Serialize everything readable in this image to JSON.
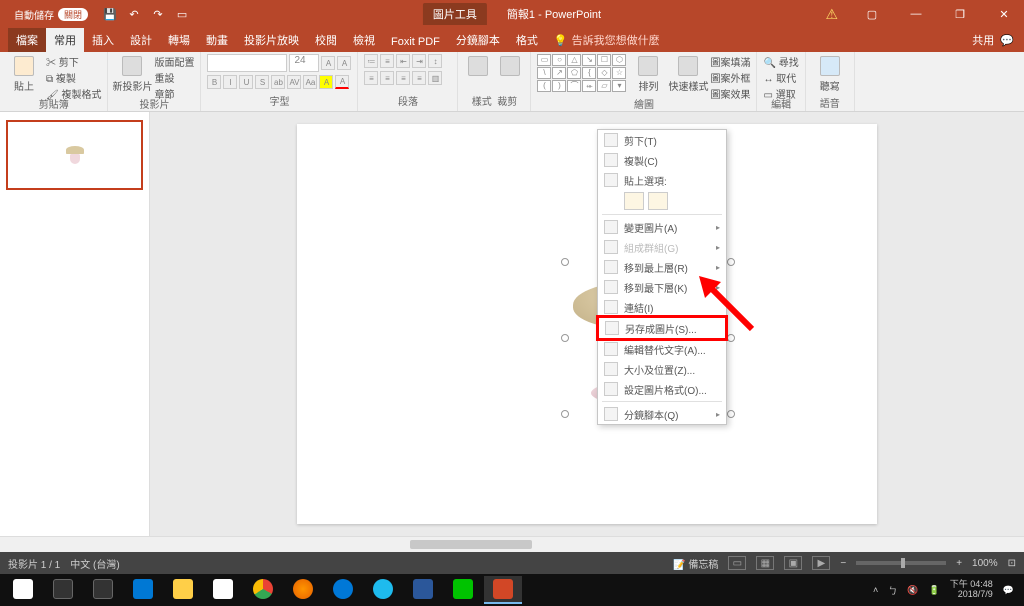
{
  "title": {
    "picture_tools": "圖片工具",
    "doc": "簡報1 - PowerPoint",
    "autosave_label": "自動儲存",
    "autosave_state": "關閉"
  },
  "wincontrols": {
    "share": "共用"
  },
  "tabs": {
    "file": "檔案",
    "home": "常用",
    "insert": "插入",
    "design": "設計",
    "transitions": "轉場",
    "animations": "動畫",
    "slideshow": "投影片放映",
    "review": "校閱",
    "view": "檢視",
    "foxit": "Foxit PDF",
    "storyboard": "分鏡腳本",
    "format": "格式",
    "tellme": "告訴我您想做什麼"
  },
  "ribbon": {
    "clipboard": {
      "paste": "貼上",
      "cut": "剪下",
      "copy": "複製",
      "formatpainter": "複製格式",
      "group": "剪貼簿"
    },
    "slides": {
      "new": "新投影片",
      "layout": "版面配置",
      "reset": "重設",
      "section": "章節",
      "group": "投影片"
    },
    "font": {
      "size": "24",
      "group": "字型"
    },
    "paragraph": {
      "group": "段落"
    },
    "styles": {
      "quick": "樣式",
      "crop": "裁剪"
    },
    "drawing": {
      "arrange": "排列",
      "quickstyles": "快速樣式",
      "fill": "圖案填滿",
      "outline": "圖案外框",
      "effects": "圖案效果",
      "group": "繪圖"
    },
    "editing": {
      "find": "尋找",
      "replace": "取代",
      "select": "選取",
      "group": "編輯"
    },
    "voice": {
      "dictate": "聽寫",
      "group": "語音"
    }
  },
  "context_menu": {
    "cut": "剪下(T)",
    "copy": "複製(C)",
    "paste_label": "貼上選項:",
    "change_pic": "變更圖片(A)",
    "group_cmd": "組成群組(G)",
    "bring_front": "移到最上層(R)",
    "send_back": "移到最下層(K)",
    "link": "連結(I)",
    "save_as_pic": "另存成圖片(S)...",
    "alt_text": "編輯替代文字(A)...",
    "size_pos": "大小及位置(Z)...",
    "format_pic": "設定圖片格式(O)...",
    "storyboard": "分鏡腳本(Q)"
  },
  "status": {
    "slide": "投影片 1 / 1",
    "lang": "中文 (台灣)",
    "notes_btn": "備忘稿",
    "zoom": "100%"
  },
  "taskbar": {
    "time": "下午 04:48",
    "date": "2018/7/9"
  }
}
